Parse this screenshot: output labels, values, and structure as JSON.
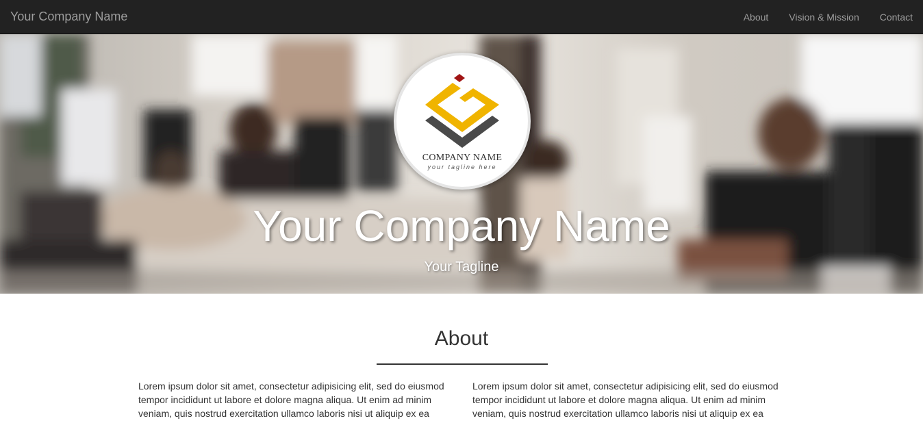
{
  "navbar": {
    "brand": "Your Company Name",
    "links": [
      {
        "label": "About"
      },
      {
        "label": "Vision & Mission"
      },
      {
        "label": "Contact"
      }
    ]
  },
  "hero": {
    "logo": {
      "name": "COMPANY NAME",
      "tagline": "your tagline here",
      "colors": {
        "accent": "#f0b400",
        "dark": "#4a4a4a",
        "red": "#a01414"
      }
    },
    "title": "Your Company Name",
    "tagline": "Your Tagline"
  },
  "about": {
    "heading": "About",
    "columns": [
      {
        "text": "Lorem ipsum dolor sit amet, consectetur adipisicing elit, sed do eiusmod tempor incididunt ut labore et dolore magna aliqua. Ut enim ad minim veniam, quis nostrud exercitation ullamco laboris nisi ut aliquip ex ea"
      },
      {
        "text": "Lorem ipsum dolor sit amet, consectetur adipisicing elit, sed do eiusmod tempor incididunt ut labore et dolore magna aliqua. Ut enim ad minim veniam, quis nostrud exercitation ullamco laboris nisi ut aliquip ex ea"
      }
    ]
  }
}
